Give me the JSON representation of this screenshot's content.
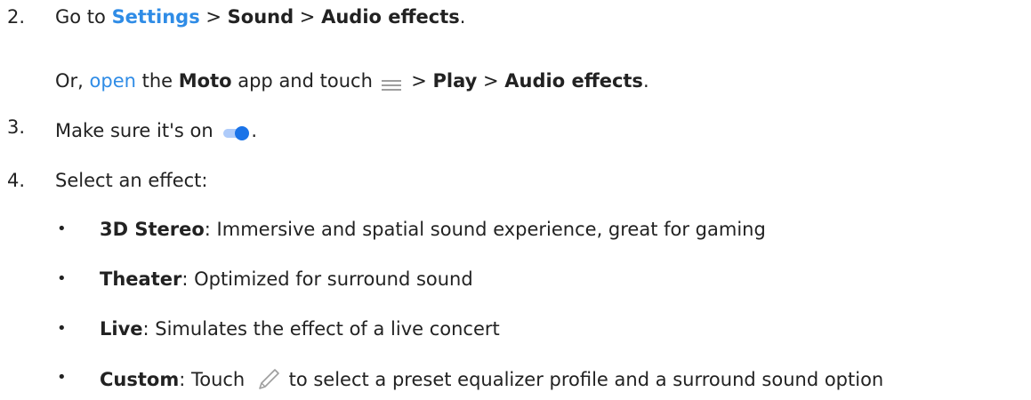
{
  "steps": [
    {
      "number": "2.",
      "parts": [
        "Go to ",
        "Settings",
        " > ",
        "Sound",
        " > ",
        "Audio effects",
        "."
      ],
      "sub": [
        "Or, ",
        "open",
        " the ",
        "Moto",
        " app and touch ",
        " > ",
        "Play",
        " > ",
        "Audio effects",
        "."
      ]
    },
    {
      "number": "3.",
      "parts": [
        "Make sure it's on ",
        "."
      ]
    },
    {
      "number": "4.",
      "parts": [
        "Select an effect:"
      ],
      "bullets": [
        {
          "term": "3D Stereo",
          "desc": ": Immersive and spatial sound experience, great for gaming"
        },
        {
          "term": "Theater",
          "desc": ": Optimized for surround sound"
        },
        {
          "term": "Live",
          "desc": ": Simulates the effect of a live concert"
        },
        {
          "term": "Custom",
          "desc_a": ": Touch ",
          "desc_b": " to select a preset equalizer profile and a surround sound option"
        }
      ]
    }
  ],
  "bullet_char": "•",
  "icons": {
    "menu": "menu-icon",
    "toggle": "toggle-on-icon",
    "edit": "pencil-icon"
  },
  "colors": {
    "link": "#2f8ce6",
    "text": "#222222",
    "toggle_track": "#aecbfa",
    "toggle_thumb": "#1a73e8",
    "icon_gray": "#9e9e9e"
  }
}
